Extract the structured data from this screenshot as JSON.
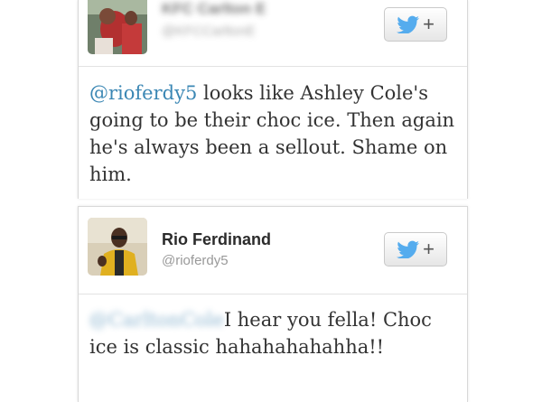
{
  "tweet1": {
    "author_name": "KFC Carlton E",
    "author_handle": "@KFCCarltonE",
    "mention": "@rioferdy5",
    "text": " looks like Ashley Cole's going to be their choc ice. Then again he's always been a sellout. Shame on him."
  },
  "tweet2": {
    "author_name": "Rio Ferdinand",
    "author_handle": "@rioferdy5",
    "mention": "@CarltonCole",
    "text": "I hear you fella! Choc ice is classic hahahahahahha!!"
  },
  "follow_button": {
    "label": "+",
    "icon": "twitter-bird-icon"
  },
  "colors": {
    "mention": "#3b87b4",
    "bird": "#55acee",
    "name": "#2b2b2b",
    "handle": "#999999"
  }
}
